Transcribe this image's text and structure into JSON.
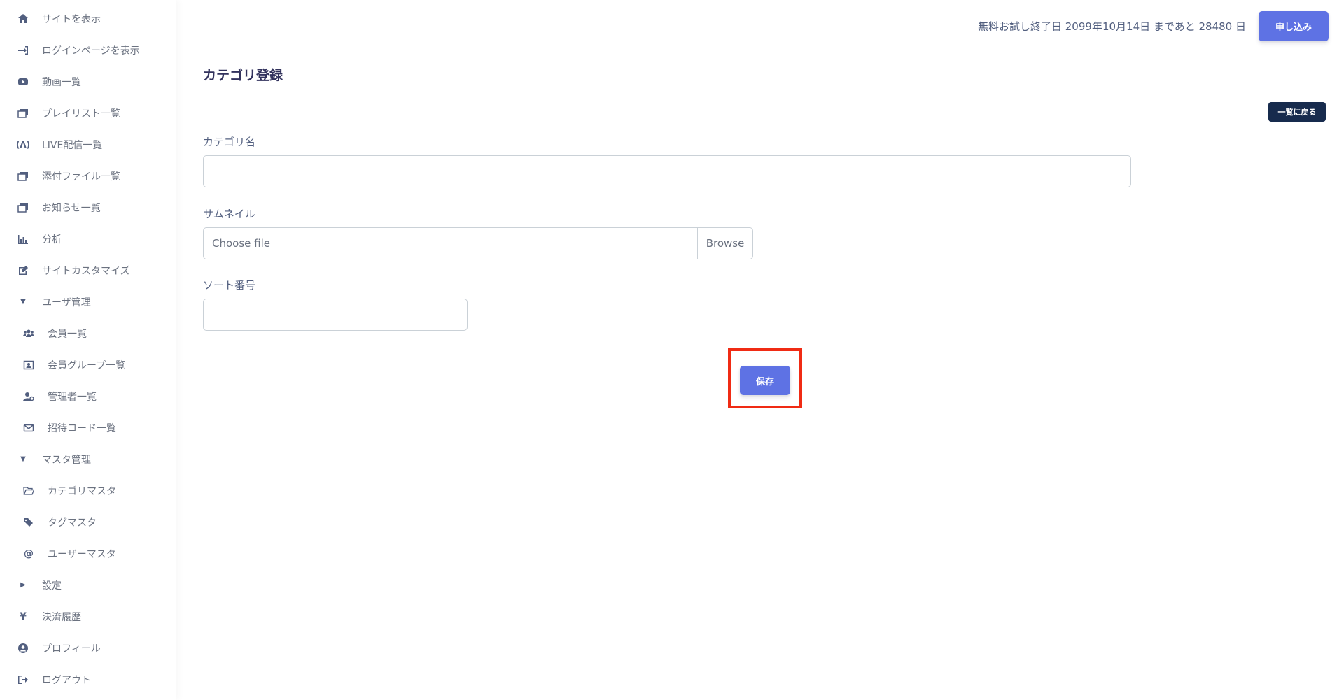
{
  "sidebar": {
    "items": [
      {
        "label": "サイトを表示",
        "icon": "home-icon"
      },
      {
        "label": "ログインページを表示",
        "icon": "sign-in-icon"
      },
      {
        "label": "動画一覧",
        "icon": "video-icon"
      },
      {
        "label": "プレイリスト一覧",
        "icon": "images-icon"
      },
      {
        "label": "LIVE配信一覧",
        "icon": "broadcast-icon"
      },
      {
        "label": "添付ファイル一覧",
        "icon": "images-icon"
      },
      {
        "label": "お知らせ一覧",
        "icon": "images-icon"
      },
      {
        "label": "分析",
        "icon": "chart-bar-icon"
      },
      {
        "label": "サイトカスタマイズ",
        "icon": "edit-icon"
      },
      {
        "label": "ユーザ管理",
        "icon": "caret-down-icon"
      },
      {
        "label": "会員一覧",
        "icon": "users-icon"
      },
      {
        "label": "会員グループ一覧",
        "icon": "group-icon"
      },
      {
        "label": "管理者一覧",
        "icon": "user-cog-icon"
      },
      {
        "label": "招待コード一覧",
        "icon": "envelope-icon"
      },
      {
        "label": "マスタ管理",
        "icon": "caret-down-icon"
      },
      {
        "label": "カテゴリマスタ",
        "icon": "folder-open-icon"
      },
      {
        "label": "タグマスタ",
        "icon": "tags-icon"
      },
      {
        "label": "ユーザーマスタ",
        "icon": "at-icon"
      },
      {
        "label": "設定",
        "icon": "caret-right-icon"
      },
      {
        "label": "決済履歴",
        "icon": "yen-icon"
      },
      {
        "label": "プロフィール",
        "icon": "user-circle-icon"
      },
      {
        "label": "ログアウト",
        "icon": "sign-out-icon"
      }
    ]
  },
  "header": {
    "trial_text": "無料お試し終了日 2099年10月14日 まであと 28480 日",
    "apply_label": "申し込み"
  },
  "main": {
    "title": "カテゴリ登録",
    "back_label": "一覧に戻る",
    "category_name_label": "カテゴリ名",
    "category_name_value": "",
    "thumbnail_label": "サムネイル",
    "thumbnail_placeholder": "Choose file",
    "browse_label": "Browse",
    "sort_label": "ソート番号",
    "sort_value": "",
    "save_label": "保存"
  },
  "colors": {
    "accent": "#5e72e4",
    "dark": "#172b4d",
    "highlight": "#f02b14"
  }
}
